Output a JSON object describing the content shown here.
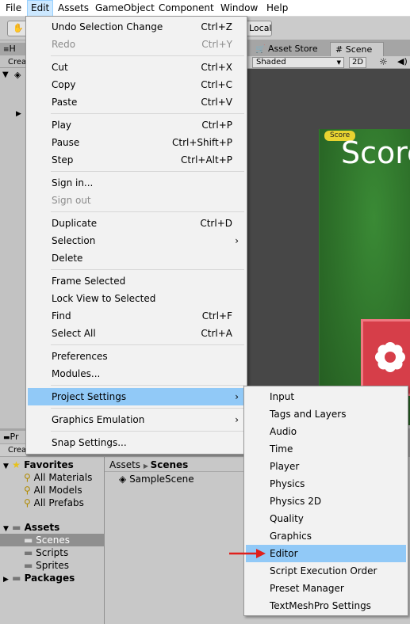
{
  "menubar": {
    "items": [
      "File",
      "Edit",
      "Assets",
      "GameObject",
      "Component",
      "Window",
      "Help"
    ]
  },
  "toolbar": {
    "local_label": "Local"
  },
  "scene_tabs": {
    "asset_store": "Asset Store",
    "scene": "Scene"
  },
  "scene_toolbar": {
    "shading": "Shaded",
    "mode_2d": "2D"
  },
  "hierarchy": {
    "tab": "H",
    "create": "Crea"
  },
  "project": {
    "tab": "Pr",
    "create": "Crea"
  },
  "scene_content": {
    "badge": "Score",
    "score_text": "Score"
  },
  "project_tree": {
    "favorites": "Favorites",
    "fav_items": [
      "All Materials",
      "All Models",
      "All Prefabs"
    ],
    "assets": "Assets",
    "asset_items": [
      "Scenes",
      "Scripts",
      "Sprites"
    ],
    "packages": "Packages"
  },
  "breadcrumb": {
    "root": "Assets",
    "current": "Scenes"
  },
  "project_files": [
    "SampleScene"
  ],
  "edit_menu": {
    "undo": {
      "label": "Undo Selection Change",
      "shortcut": "Ctrl+Z"
    },
    "redo": {
      "label": "Redo",
      "shortcut": "Ctrl+Y"
    },
    "cut": {
      "label": "Cut",
      "shortcut": "Ctrl+X"
    },
    "copy": {
      "label": "Copy",
      "shortcut": "Ctrl+C"
    },
    "paste": {
      "label": "Paste",
      "shortcut": "Ctrl+V"
    },
    "play": {
      "label": "Play",
      "shortcut": "Ctrl+P"
    },
    "pause": {
      "label": "Pause",
      "shortcut": "Ctrl+Shift+P"
    },
    "step": {
      "label": "Step",
      "shortcut": "Ctrl+Alt+P"
    },
    "sign_in": {
      "label": "Sign in..."
    },
    "sign_out": {
      "label": "Sign out"
    },
    "duplicate": {
      "label": "Duplicate",
      "shortcut": "Ctrl+D"
    },
    "selection": {
      "label": "Selection"
    },
    "delete": {
      "label": "Delete"
    },
    "frame_selected": {
      "label": "Frame Selected"
    },
    "lock_view": {
      "label": "Lock View to Selected"
    },
    "find": {
      "label": "Find",
      "shortcut": "Ctrl+F"
    },
    "select_all": {
      "label": "Select All",
      "shortcut": "Ctrl+A"
    },
    "preferences": {
      "label": "Preferences"
    },
    "modules": {
      "label": "Modules..."
    },
    "project_settings": {
      "label": "Project Settings"
    },
    "graphics_emulation": {
      "label": "Graphics Emulation"
    },
    "snap_settings": {
      "label": "Snap Settings..."
    }
  },
  "project_settings_menu": {
    "items": [
      "Input",
      "Tags and Layers",
      "Audio",
      "Time",
      "Player",
      "Physics",
      "Physics 2D",
      "Quality",
      "Graphics",
      "Editor",
      "Script Execution Order",
      "Preset Manager",
      "TextMeshPro Settings"
    ],
    "highlighted": "Editor"
  },
  "colors": {
    "menu_highlight": "#91c9f7",
    "scene_green": "#2d6f29",
    "card_red": "#d63e49",
    "annotation_arrow": "#e0201d"
  }
}
